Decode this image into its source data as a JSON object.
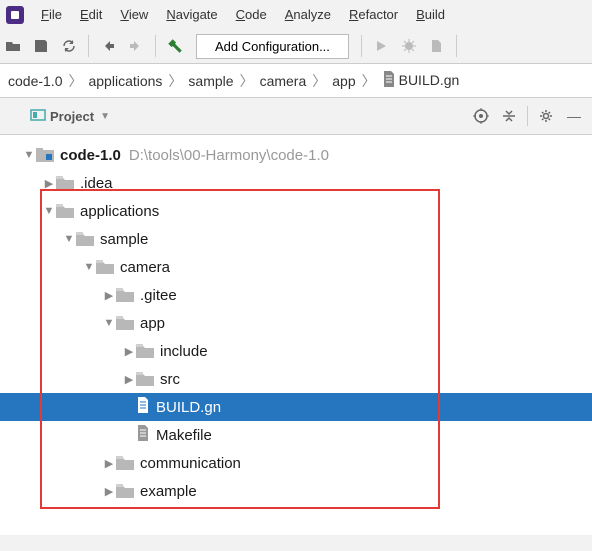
{
  "menu": {
    "file": "File",
    "edit": "Edit",
    "view": "View",
    "navigate": "Navigate",
    "code": "Code",
    "analyze": "Analyze",
    "refactor": "Refactor",
    "build": "Build"
  },
  "toolbar": {
    "add_config": "Add Configuration..."
  },
  "breadcrumb": [
    "code-1.0",
    "applications",
    "sample",
    "camera",
    "app",
    "BUILD.gn"
  ],
  "panel": {
    "title": "Project"
  },
  "tree": {
    "root": {
      "name": "code-1.0",
      "path": "D:\\tools\\00-Harmony\\code-1.0"
    },
    "items": [
      {
        "depth": 1,
        "arrow": "▶",
        "icon": "folder-gray",
        "label": ".idea"
      },
      {
        "depth": 1,
        "arrow": "▼",
        "icon": "folder-gray",
        "label": "applications"
      },
      {
        "depth": 2,
        "arrow": "▼",
        "icon": "folder-gray",
        "label": "sample"
      },
      {
        "depth": 3,
        "arrow": "▼",
        "icon": "folder-gray",
        "label": "camera"
      },
      {
        "depth": 4,
        "arrow": "▶",
        "icon": "folder-gray",
        "label": ".gitee"
      },
      {
        "depth": 4,
        "arrow": "▼",
        "icon": "folder-gray",
        "label": "app"
      },
      {
        "depth": 5,
        "arrow": "▶",
        "icon": "folder-gray",
        "label": "include"
      },
      {
        "depth": 5,
        "arrow": "▶",
        "icon": "folder-gray",
        "label": "src"
      },
      {
        "depth": 5,
        "arrow": "",
        "icon": "file",
        "label": "BUILD.gn",
        "selected": true
      },
      {
        "depth": 5,
        "arrow": "",
        "icon": "file",
        "label": "Makefile"
      },
      {
        "depth": 4,
        "arrow": "▶",
        "icon": "folder-gray",
        "label": "communication"
      },
      {
        "depth": 4,
        "arrow": "▶",
        "icon": "folder-gray",
        "label": "example"
      }
    ]
  }
}
